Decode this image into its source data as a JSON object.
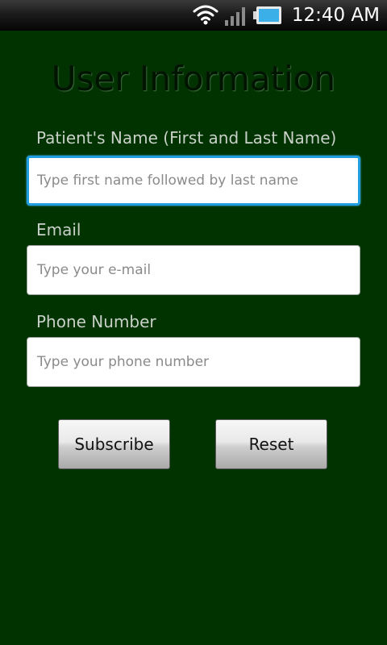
{
  "status_bar": {
    "time": "12:40 AM",
    "icons": [
      "wifi-icon",
      "signal-icon",
      "battery-icon"
    ]
  },
  "form": {
    "title": "User Information",
    "fields": [
      {
        "label": "Patient's Name (First and Last Name)",
        "placeholder": "Type first name followed by last name",
        "value": "",
        "focused": true
      },
      {
        "label": "Email",
        "placeholder": "Type your e-mail",
        "value": "",
        "focused": false
      },
      {
        "label": "Phone Number",
        "placeholder": "Type your phone number",
        "value": "",
        "focused": false
      }
    ],
    "buttons": {
      "subscribe_label": "Subscribe",
      "reset_label": "Reset"
    }
  },
  "colors": {
    "background": "#003300",
    "label_text": "#c8d0c8",
    "focus_border": "#1f9ee0",
    "battery": "#3bb0e8"
  }
}
